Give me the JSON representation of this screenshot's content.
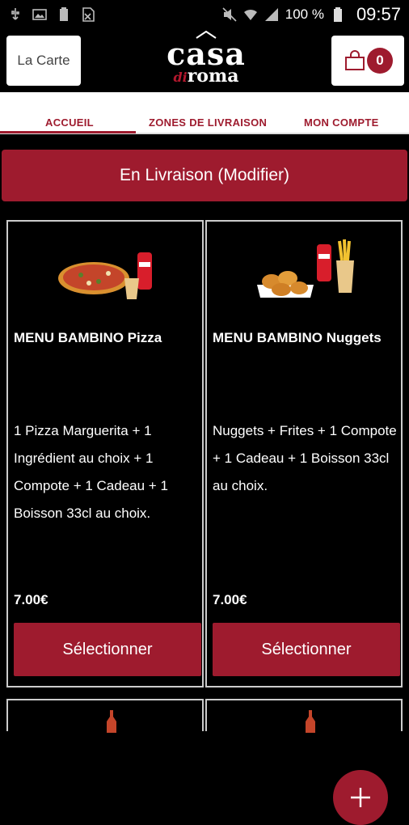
{
  "statusbar": {
    "battery": "100 %",
    "time": "09:57"
  },
  "header": {
    "menu_label": "La Carte",
    "logo_top": "casa",
    "logo_di": "di",
    "logo_bottom": "roma",
    "cart_count": "0"
  },
  "tabs": [
    {
      "label": "ACCUEIL"
    },
    {
      "label": "ZONES DE LIVRAISON"
    },
    {
      "label": "MON COMPTE"
    }
  ],
  "delivery": {
    "label": "En Livraison (Modifier)"
  },
  "products": [
    {
      "title": "MENU BAMBINO Pizza",
      "desc": "1 Pizza Marguerita  + 1 Ingrédient au choix  + 1 Compote  + 1 Cadeau  + 1 Boisson 33cl au choix.",
      "price": "7.00€",
      "button": "Sélectionner"
    },
    {
      "title": "MENU BAMBINO Nuggets",
      "desc": "Nuggets  + Frites  + 1 Compote  + 1 Cadeau  + 1 Boisson 33cl au choix.",
      "price": "7.00€",
      "button": "Sélectionner"
    }
  ],
  "colors": {
    "accent": "#9e1b2e",
    "background": "#000000"
  }
}
